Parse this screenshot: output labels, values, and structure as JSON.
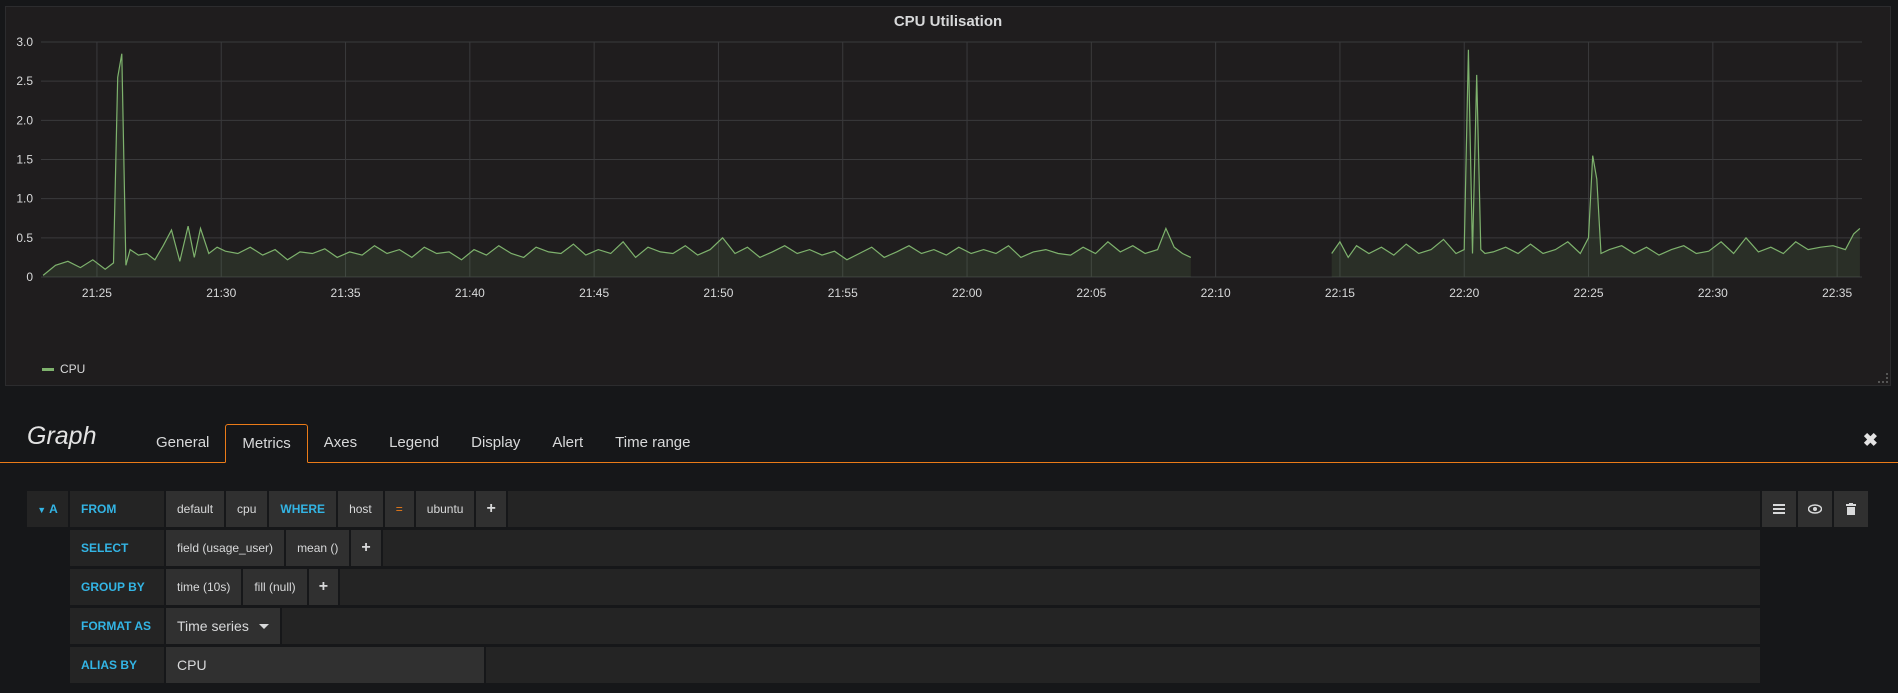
{
  "panel": {
    "title": "CPU Utilisation",
    "legend_series": "CPU",
    "series_color": "#7eb26d"
  },
  "chart_data": {
    "type": "line",
    "title": "CPU Utilisation",
    "xlabel": "",
    "ylabel": "",
    "ylim": [
      0,
      3.0
    ],
    "y_ticks": [
      "0",
      "0.5",
      "1.0",
      "1.5",
      "2.0",
      "2.5",
      "3.0"
    ],
    "x_ticks": [
      "21:25",
      "21:30",
      "21:35",
      "21:40",
      "21:45",
      "21:50",
      "21:55",
      "22:00",
      "22:05",
      "22:10",
      "22:15",
      "22:20",
      "22:25",
      "22:30",
      "22:35"
    ],
    "xlim": [
      "21:22:45",
      "22:36:00"
    ],
    "grid": true,
    "legend_placement": "bottom-left",
    "series": [
      {
        "name": "CPU",
        "color": "#7eb26d",
        "fill": true,
        "segments": [
          {
            "x": [
              "21:22:50",
              "21:23:20",
              "21:23:50",
              "21:24:20",
              "21:24:50",
              "21:25:20",
              "21:25:40",
              "21:25:50",
              "21:26:00",
              "21:26:10",
              "21:26:20",
              "21:26:40",
              "21:27:00",
              "21:27:20",
              "21:27:40",
              "21:28:00",
              "21:28:20",
              "21:28:40",
              "21:28:55",
              "21:29:10",
              "21:29:30",
              "21:29:50",
              "21:30:10",
              "21:30:40",
              "21:31:10",
              "21:31:40",
              "21:32:10",
              "21:32:40",
              "21:33:10",
              "21:33:40",
              "21:34:10",
              "21:34:40",
              "21:35:10",
              "21:35:40",
              "21:36:10",
              "21:36:40",
              "21:37:10",
              "21:37:40",
              "21:38:10",
              "21:38:40",
              "21:39:10",
              "21:39:40",
              "21:40:10",
              "21:40:40",
              "21:41:10",
              "21:41:40",
              "21:42:10",
              "21:42:40",
              "21:43:10",
              "21:43:40",
              "21:44:10",
              "21:44:40",
              "21:45:10",
              "21:45:40",
              "21:46:10",
              "21:46:40",
              "21:47:10",
              "21:47:40",
              "21:48:10",
              "21:48:40",
              "21:49:10",
              "21:49:40",
              "21:50:10",
              "21:50:40",
              "21:51:10",
              "21:51:40",
              "21:52:10",
              "21:52:40",
              "21:53:10",
              "21:53:40",
              "21:54:10",
              "21:54:40",
              "21:55:10",
              "21:55:40",
              "21:56:10",
              "21:56:40",
              "21:57:10",
              "21:57:40",
              "21:58:10",
              "21:58:40",
              "21:59:10",
              "21:59:40",
              "22:00:10",
              "22:00:40",
              "22:01:10",
              "22:01:40",
              "22:02:10",
              "22:02:40",
              "22:03:10",
              "22:03:40",
              "22:04:10",
              "22:04:40",
              "22:05:10",
              "22:05:40",
              "22:06:10",
              "22:06:40",
              "22:07:10",
              "22:07:40",
              "22:08:00",
              "22:08:20",
              "22:08:40",
              "22:09:00"
            ],
            "y": [
              0.02,
              0.15,
              0.2,
              0.12,
              0.22,
              0.1,
              0.18,
              2.55,
              2.85,
              0.15,
              0.35,
              0.28,
              0.3,
              0.22,
              0.4,
              0.6,
              0.2,
              0.65,
              0.25,
              0.62,
              0.3,
              0.38,
              0.33,
              0.3,
              0.38,
              0.28,
              0.35,
              0.22,
              0.32,
              0.3,
              0.36,
              0.25,
              0.32,
              0.28,
              0.4,
              0.3,
              0.35,
              0.25,
              0.38,
              0.3,
              0.32,
              0.22,
              0.35,
              0.28,
              0.4,
              0.3,
              0.25,
              0.38,
              0.32,
              0.3,
              0.42,
              0.28,
              0.35,
              0.3,
              0.45,
              0.25,
              0.38,
              0.32,
              0.3,
              0.4,
              0.28,
              0.35,
              0.5,
              0.3,
              0.38,
              0.25,
              0.32,
              0.4,
              0.3,
              0.35,
              0.28,
              0.33,
              0.22,
              0.3,
              0.38,
              0.25,
              0.32,
              0.4,
              0.3,
              0.35,
              0.28,
              0.38,
              0.3,
              0.35,
              0.3,
              0.4,
              0.25,
              0.32,
              0.35,
              0.3,
              0.28,
              0.38,
              0.3,
              0.45,
              0.32,
              0.4,
              0.3,
              0.35,
              0.62,
              0.38,
              0.3,
              0.25
            ]
          },
          {
            "x": [
              "22:14:40",
              "22:15:00",
              "22:15:20",
              "22:15:40",
              "22:16:10",
              "22:16:40",
              "22:17:10",
              "22:17:40",
              "22:18:10",
              "22:18:40",
              "22:19:10",
              "22:19:40",
              "22:20:00",
              "22:20:10",
              "22:20:20",
              "22:20:30",
              "22:20:40",
              "22:20:50",
              "22:21:10",
              "22:21:40",
              "22:22:10",
              "22:22:40",
              "22:23:10",
              "22:23:40",
              "22:24:10",
              "22:24:40",
              "22:25:00",
              "22:25:10",
              "22:25:20",
              "22:25:30",
              "22:25:50",
              "22:26:20",
              "22:26:50",
              "22:27:20",
              "22:27:50",
              "22:28:20",
              "22:28:50",
              "22:29:20",
              "22:29:50",
              "22:30:20",
              "22:30:50",
              "22:31:20",
              "22:31:50",
              "22:32:20",
              "22:32:50",
              "22:33:20",
              "22:33:50",
              "22:34:20",
              "22:34:50",
              "22:35:20",
              "22:35:40",
              "22:35:55"
            ],
            "y": [
              0.3,
              0.45,
              0.25,
              0.4,
              0.3,
              0.38,
              0.28,
              0.42,
              0.3,
              0.35,
              0.48,
              0.3,
              0.35,
              2.9,
              0.3,
              2.58,
              0.35,
              0.3,
              0.32,
              0.38,
              0.3,
              0.42,
              0.3,
              0.35,
              0.45,
              0.3,
              0.5,
              1.55,
              1.25,
              0.3,
              0.35,
              0.4,
              0.3,
              0.38,
              0.28,
              0.35,
              0.4,
              0.3,
              0.33,
              0.45,
              0.3,
              0.5,
              0.32,
              0.38,
              0.3,
              0.45,
              0.35,
              0.38,
              0.4,
              0.35,
              0.55,
              0.62
            ]
          }
        ]
      }
    ]
  },
  "editor": {
    "title": "Graph",
    "tabs": [
      "General",
      "Metrics",
      "Axes",
      "Legend",
      "Display",
      "Alert",
      "Time range"
    ],
    "active_tab": "Metrics"
  },
  "query": {
    "ref_id": "A",
    "from_label": "FROM",
    "from_policy": "default",
    "from_measurement": "cpu",
    "where_label": "WHERE",
    "where_key": "host",
    "where_op": "=",
    "where_value": "ubuntu",
    "select_label": "SELECT",
    "select_field": "field (usage_user)",
    "select_func": "mean ()",
    "groupby_label": "GROUP BY",
    "groupby_time": "time (10s)",
    "groupby_fill": "fill (null)",
    "format_label": "FORMAT AS",
    "format_value": "Time series",
    "alias_label": "ALIAS BY",
    "alias_value": "CPU",
    "plus": "+"
  }
}
